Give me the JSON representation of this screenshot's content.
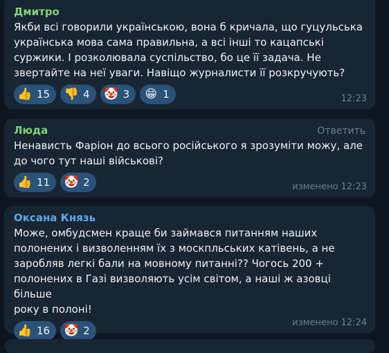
{
  "colors": {
    "background": "#0e1621",
    "bubble": "#182533",
    "reaction_pill": "#2b5278",
    "name_green": "#7fd47a",
    "name_blue": "#5ea9e6",
    "meta_gray": "#6d7f8f"
  },
  "messages": [
    {
      "author": "Дмитро",
      "text": "Якби всі говорили українською, вона б кричала, що гуцульська\nукраїнська мова сама правильна, а всі інші то кацапські\nсуржики. І розколювала суспільство, бо це її задача.  Не\nзвертайте на неї уваги. Навіщо журналисти її розкручують?",
      "reactions": [
        {
          "icon": "thumbs-up",
          "count": "15"
        },
        {
          "icon": "thumbs-down",
          "count": "4"
        },
        {
          "icon": "clown-face",
          "count": "3"
        },
        {
          "icon": "grinning-face",
          "count": "1"
        }
      ],
      "time": "12:23"
    },
    {
      "author": "Люда",
      "reply_label": "Ответить",
      "text": "Ненависть Фаріон до всього російського я зрозуміти можу, але\nдо чого тут наші військові?",
      "reactions": [
        {
          "icon": "thumbs-up",
          "count": "11"
        },
        {
          "icon": "clown-face",
          "count": "2"
        }
      ],
      "time": "изменено 12:23"
    },
    {
      "author": "Оксана Князь",
      "text": "Може, омбудсмен краще би займався питанням наших\nполонених і визволенням їх з москпльських катівень, а не\nзаробляв легкі бали на мовному питанні?? Чогось 200 +\nполонених в Газі визволяють усім світом, а наші ж азовці більше\nроку в полоні!",
      "reactions": [
        {
          "icon": "thumbs-up",
          "count": "16"
        },
        {
          "icon": "clown-face",
          "count": "2"
        }
      ],
      "time": "изменено 12:24"
    }
  ]
}
